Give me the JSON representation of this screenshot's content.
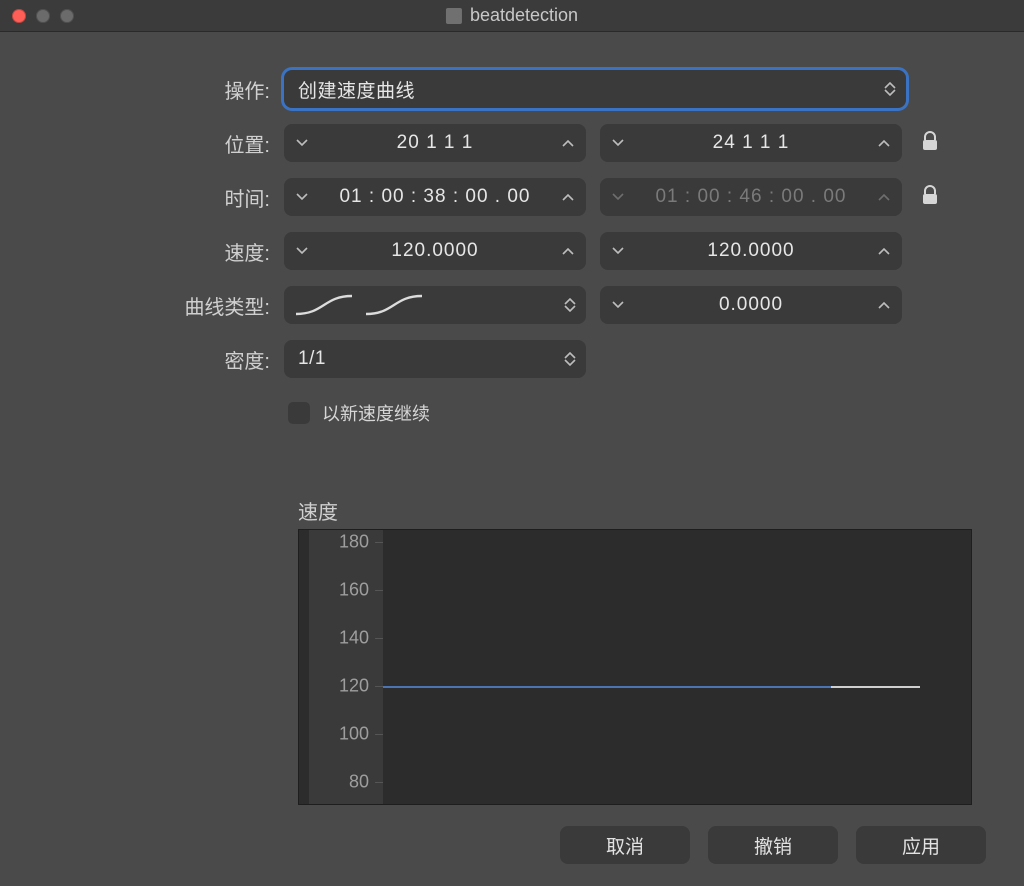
{
  "window": {
    "title": "beatdetection"
  },
  "labels": {
    "operation": "操作:",
    "position": "位置:",
    "time": "时间:",
    "tempo": "速度:",
    "curve_type": "曲线类型:",
    "density": "密度:",
    "continue_with_new_tempo": "以新速度继续",
    "tempo_chart": "速度"
  },
  "operation": {
    "selected": "创建速度曲线"
  },
  "position": {
    "start": "20 1 1    1",
    "end": "24 1 1    1",
    "locked": false
  },
  "time": {
    "start": "01 : 00 : 38 : 00 . 00",
    "end": "01 : 00 : 46 : 00 . 00",
    "end_dimmed": true,
    "locked": false
  },
  "tempo": {
    "start": "120.0000",
    "end": "120.0000"
  },
  "curve": {
    "type_icon": "ease-in-out-pair",
    "value": "0.0000"
  },
  "density": {
    "value": "1/1"
  },
  "continue_checked": false,
  "buttons": {
    "cancel": "取消",
    "undo": "撤销",
    "apply": "应用"
  },
  "chart_data": {
    "type": "line",
    "ylabel": "速度",
    "ylim": [
      70,
      185
    ],
    "yticks": [
      80,
      100,
      120,
      140,
      160,
      180
    ],
    "series": [
      {
        "name": "tempo",
        "values": [
          120,
          120
        ],
        "color": "#4b74b3",
        "x_range_fraction": [
          0.0,
          0.76
        ]
      },
      {
        "name": "tempo-tail",
        "values": [
          120,
          120
        ],
        "color": "#cfcfcf",
        "x_range_fraction": [
          0.76,
          0.91
        ]
      }
    ]
  }
}
